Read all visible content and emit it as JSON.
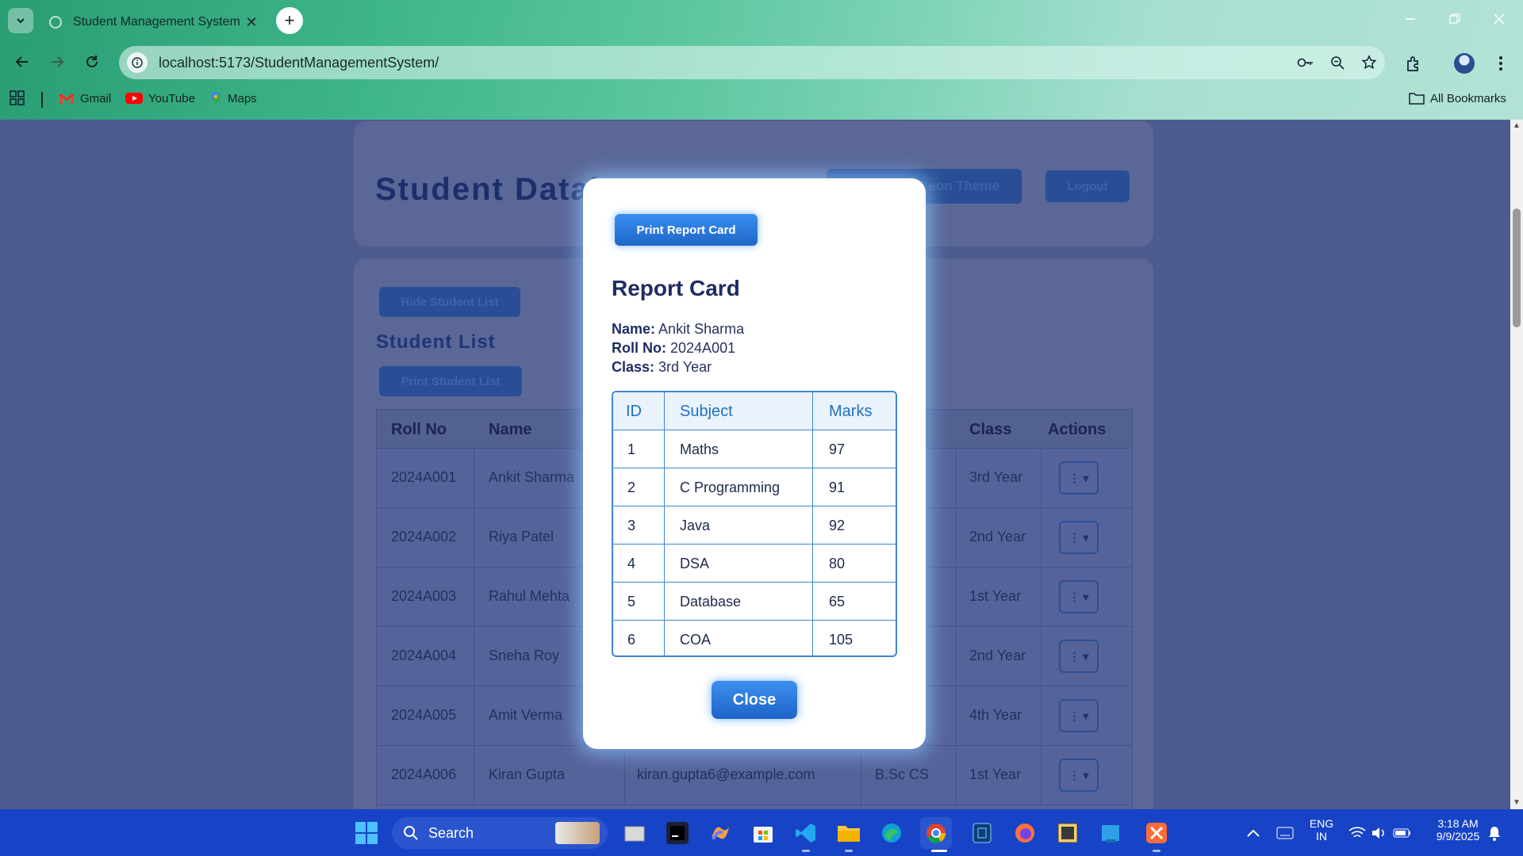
{
  "browser": {
    "tab_title": "Student Management System",
    "url": "localhost:5173/StudentManagementSystem/",
    "bookmarks": [
      {
        "label": "Gmail",
        "icon": "gmail-icon"
      },
      {
        "label": "YouTube",
        "icon": "youtube-icon"
      },
      {
        "label": "Maps",
        "icon": "maps-icon"
      }
    ],
    "all_bookmarks_label": "All Bookmarks"
  },
  "page": {
    "db_title": "Student Datab",
    "theme_button": "eon Theme",
    "logout_button": "Logout",
    "hide_list_button": "Hide Student List",
    "list_title": "Student List",
    "print_list_button": "Print Student List",
    "table_headers": [
      "Roll No",
      "Name",
      "Class",
      "Actions"
    ],
    "rows": [
      {
        "roll": "2024A001",
        "name": "Ankit Sharma",
        "email": "",
        "course": "",
        "class": "3rd Year"
      },
      {
        "roll": "2024A002",
        "name": "Riya Patel",
        "email": "",
        "course": "",
        "class": "2nd Year"
      },
      {
        "roll": "2024A003",
        "name": "Rahul Mehta",
        "email": "",
        "course": "",
        "class": "1st Year"
      },
      {
        "roll": "2024A004",
        "name": "Sneha Roy",
        "email": "",
        "course": "",
        "class": "2nd Year"
      },
      {
        "roll": "2024A005",
        "name": "Amit Verma",
        "email": "",
        "course": "",
        "class": "4th Year"
      },
      {
        "roll": "2024A006",
        "name": "Kiran Gupta",
        "email": "kiran.gupta6@example.com",
        "course": "B.Sc CS",
        "class": "1st Year"
      }
    ],
    "action_glyph": "⋮ ▾"
  },
  "modal": {
    "print_button": "Print Report Card",
    "title": "Report Card",
    "name_label": "Name:",
    "name_value": "Ankit Sharma",
    "roll_label": "Roll No:",
    "roll_value": "2024A001",
    "class_label": "Class:",
    "class_value": "3rd Year",
    "table_headers": [
      "ID",
      "Subject",
      "Marks"
    ],
    "marks": [
      {
        "id": "1",
        "subject": "Maths",
        "marks": "97"
      },
      {
        "id": "2",
        "subject": "C Programming",
        "marks": "91"
      },
      {
        "id": "3",
        "subject": "Java",
        "marks": "92"
      },
      {
        "id": "4",
        "subject": "DSA",
        "marks": "80"
      },
      {
        "id": "5",
        "subject": "Database",
        "marks": "65"
      },
      {
        "id": "6",
        "subject": "COA",
        "marks": "105"
      }
    ],
    "close_button": "Close"
  },
  "taskbar": {
    "search_label": "Search",
    "lang_top": "ENG",
    "lang_bottom": "IN",
    "time": "3:18 AM",
    "date": "9/9/2025"
  },
  "colors": {
    "accent_blue": "#1f67c9",
    "taskbar": "#1744c6",
    "overlay_page": "#4d5b8f"
  }
}
